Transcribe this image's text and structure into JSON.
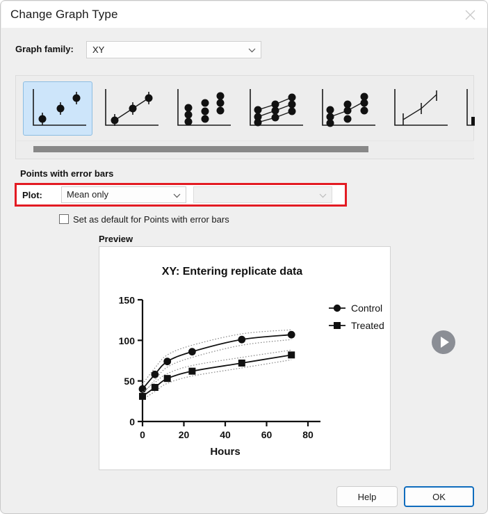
{
  "window": {
    "title": "Change Graph Type",
    "close_icon": "close-icon"
  },
  "family": {
    "label": "Graph family:",
    "value": "XY",
    "chevron_icon": "chevron-down-icon"
  },
  "thumbnails": {
    "scrollbar_icon": "horizontal-scrollbar",
    "items": [
      {
        "name": "points-with-error-bars",
        "selected": true
      },
      {
        "name": "points-with-connecting-line",
        "selected": false
      },
      {
        "name": "scatter-replicates",
        "selected": false
      },
      {
        "name": "multiple-series-connected",
        "selected": false
      },
      {
        "name": "scatter-with-mean-line",
        "selected": false
      },
      {
        "name": "line-with-error-bars",
        "selected": false
      },
      {
        "name": "partial-thumbnail",
        "selected": false
      }
    ]
  },
  "group": {
    "title": "Points with error bars",
    "plot_label": "Plot:",
    "plot_value": "Mean only",
    "plot_chevron_icon": "chevron-down-icon",
    "secondary_value": "",
    "secondary_chevron_icon": "chevron-down-icon",
    "highlight_color": "#e31b23"
  },
  "set_default": {
    "label": "Set as default for Points with error bars",
    "checked": false
  },
  "preview": {
    "label": "Preview",
    "next_icon": "play-circle-icon"
  },
  "footer": {
    "help_label": "Help",
    "ok_label": "OK",
    "ok_accent": "#0f6cbd"
  },
  "chart_data": {
    "type": "line",
    "title": "XY: Entering replicate data",
    "xlabel": "Hours",
    "ylabel": "",
    "xlim": [
      0,
      80
    ],
    "ylim": [
      0,
      150
    ],
    "xticks": [
      0,
      20,
      40,
      60,
      80
    ],
    "yticks": [
      0,
      50,
      100,
      150
    ],
    "grid": false,
    "legend_position": "top-right",
    "x": [
      0,
      6,
      12,
      24,
      48,
      72
    ],
    "series": [
      {
        "name": "Control",
        "marker": "circle",
        "values": [
          40,
          58,
          74,
          86,
          101,
          107
        ],
        "ci_upper": [
          46,
          66,
          82,
          94,
          108,
          113
        ],
        "ci_lower": [
          34,
          51,
          67,
          79,
          94,
          101
        ]
      },
      {
        "name": "Treated",
        "marker": "square",
        "values": [
          31,
          42,
          53,
          62,
          72,
          82
        ],
        "ci_upper": [
          36,
          48,
          59,
          69,
          79,
          88
        ],
        "ci_lower": [
          27,
          37,
          47,
          56,
          66,
          76
        ]
      }
    ]
  }
}
